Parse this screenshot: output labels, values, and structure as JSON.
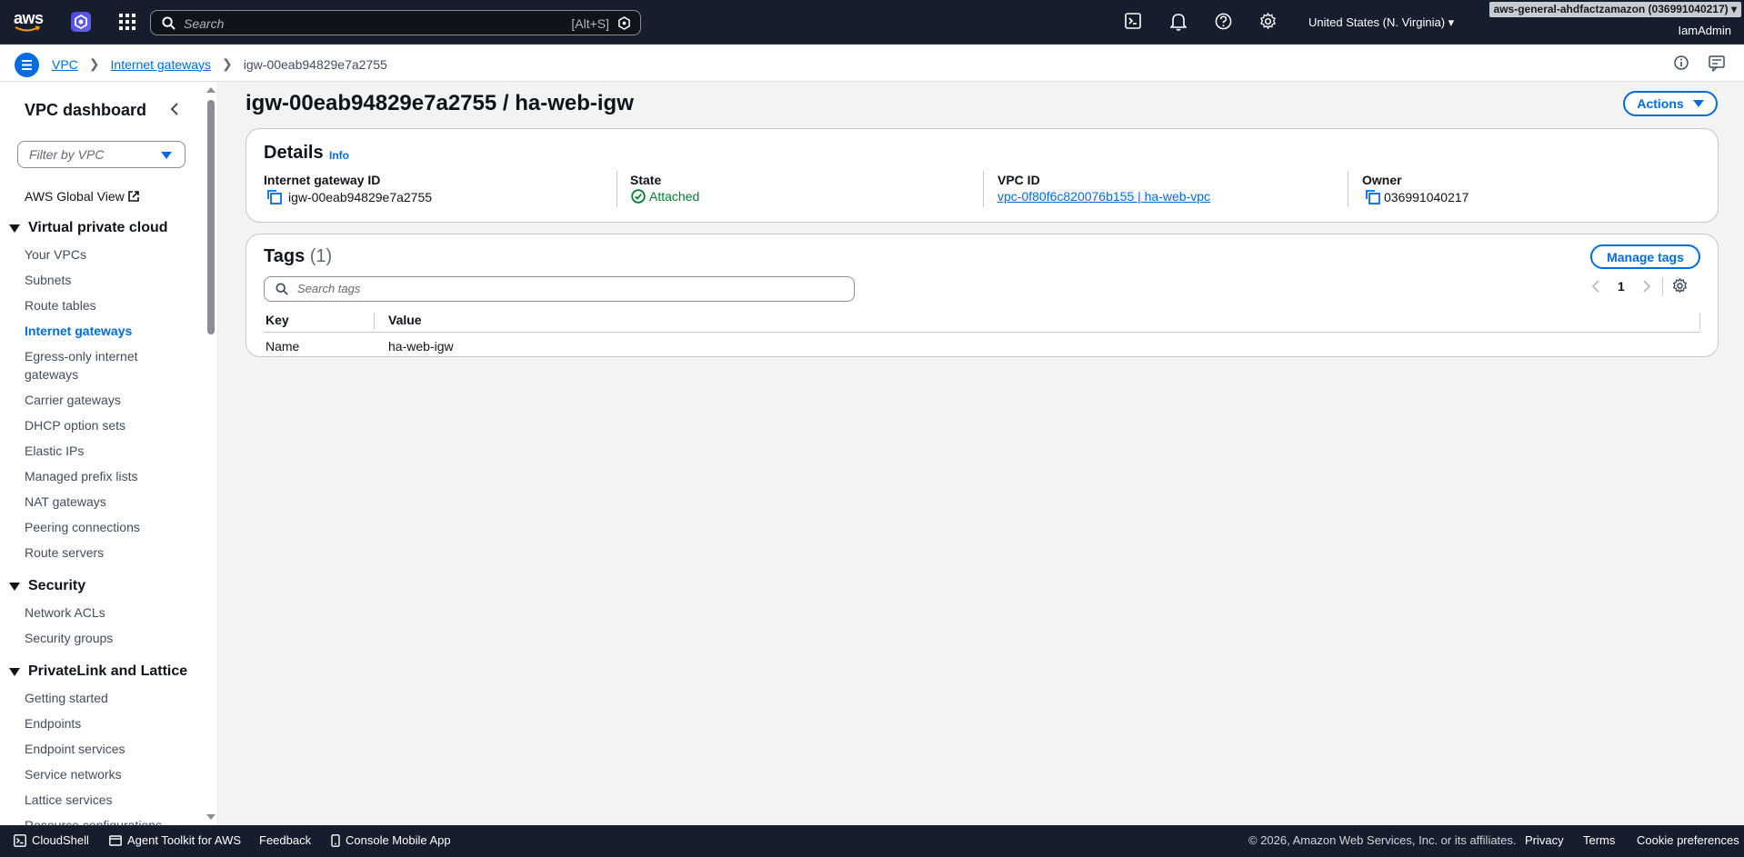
{
  "topnav": {
    "logo_text": "aws",
    "search_placeholder": "Search",
    "search_shortcut": "[Alt+S]",
    "region": "United States (N. Virginia)",
    "account": "aws-general-ahdfactzamazon (036991040217)",
    "user": "IamAdmin"
  },
  "breadcrumb": {
    "items": [
      "VPC",
      "Internet gateways"
    ],
    "current": "igw-00eab94829e7a2755"
  },
  "sidebar": {
    "title": "VPC dashboard",
    "filter_placeholder": "Filter by VPC",
    "global_view": "AWS Global View",
    "sections": [
      {
        "title": "Virtual private cloud",
        "items": [
          "Your VPCs",
          "Subnets",
          "Route tables",
          "Internet gateways",
          "Egress-only internet gateways",
          "Carrier gateways",
          "DHCP option sets",
          "Elastic IPs",
          "Managed prefix lists",
          "NAT gateways",
          "Peering connections",
          "Route servers"
        ]
      },
      {
        "title": "Security",
        "items": [
          "Network ACLs",
          "Security groups"
        ]
      },
      {
        "title": "PrivateLink and Lattice",
        "items": [
          "Getting started",
          "Endpoints",
          "Endpoint services",
          "Service networks",
          "Lattice services",
          "Resource configurations"
        ]
      }
    ],
    "egress_line1": "Egress-only internet",
    "egress_line2": "gateways"
  },
  "main": {
    "title": "igw-00eab94829e7a2755 / ha-web-igw",
    "actions_label": "Actions",
    "details": {
      "heading": "Details",
      "info": "Info",
      "fields": [
        {
          "label": "Internet gateway ID",
          "value": "igw-00eab94829e7a2755"
        },
        {
          "label": "State",
          "value": "Attached"
        },
        {
          "label": "VPC ID",
          "value": "vpc-0f80f6c820076b155 | ha-web-vpc"
        },
        {
          "label": "Owner",
          "value": "036991040217"
        }
      ]
    },
    "tags": {
      "heading": "Tags",
      "count": "(1)",
      "manage_label": "Manage tags",
      "search_placeholder": "Search tags",
      "page": "1",
      "columns": [
        "Key",
        "Value"
      ],
      "rows": [
        [
          "Name",
          "ha-web-igw"
        ]
      ]
    }
  },
  "footer": {
    "cloudshell": "CloudShell",
    "agent_toolkit": "Agent Toolkit for AWS",
    "feedback": "Feedback",
    "mobile_app": "Console Mobile App",
    "copyright": "© 2026, Amazon Web Services, Inc. or its affiliates.",
    "privacy": "Privacy",
    "terms": "Terms",
    "cookies": "Cookie preferences"
  }
}
